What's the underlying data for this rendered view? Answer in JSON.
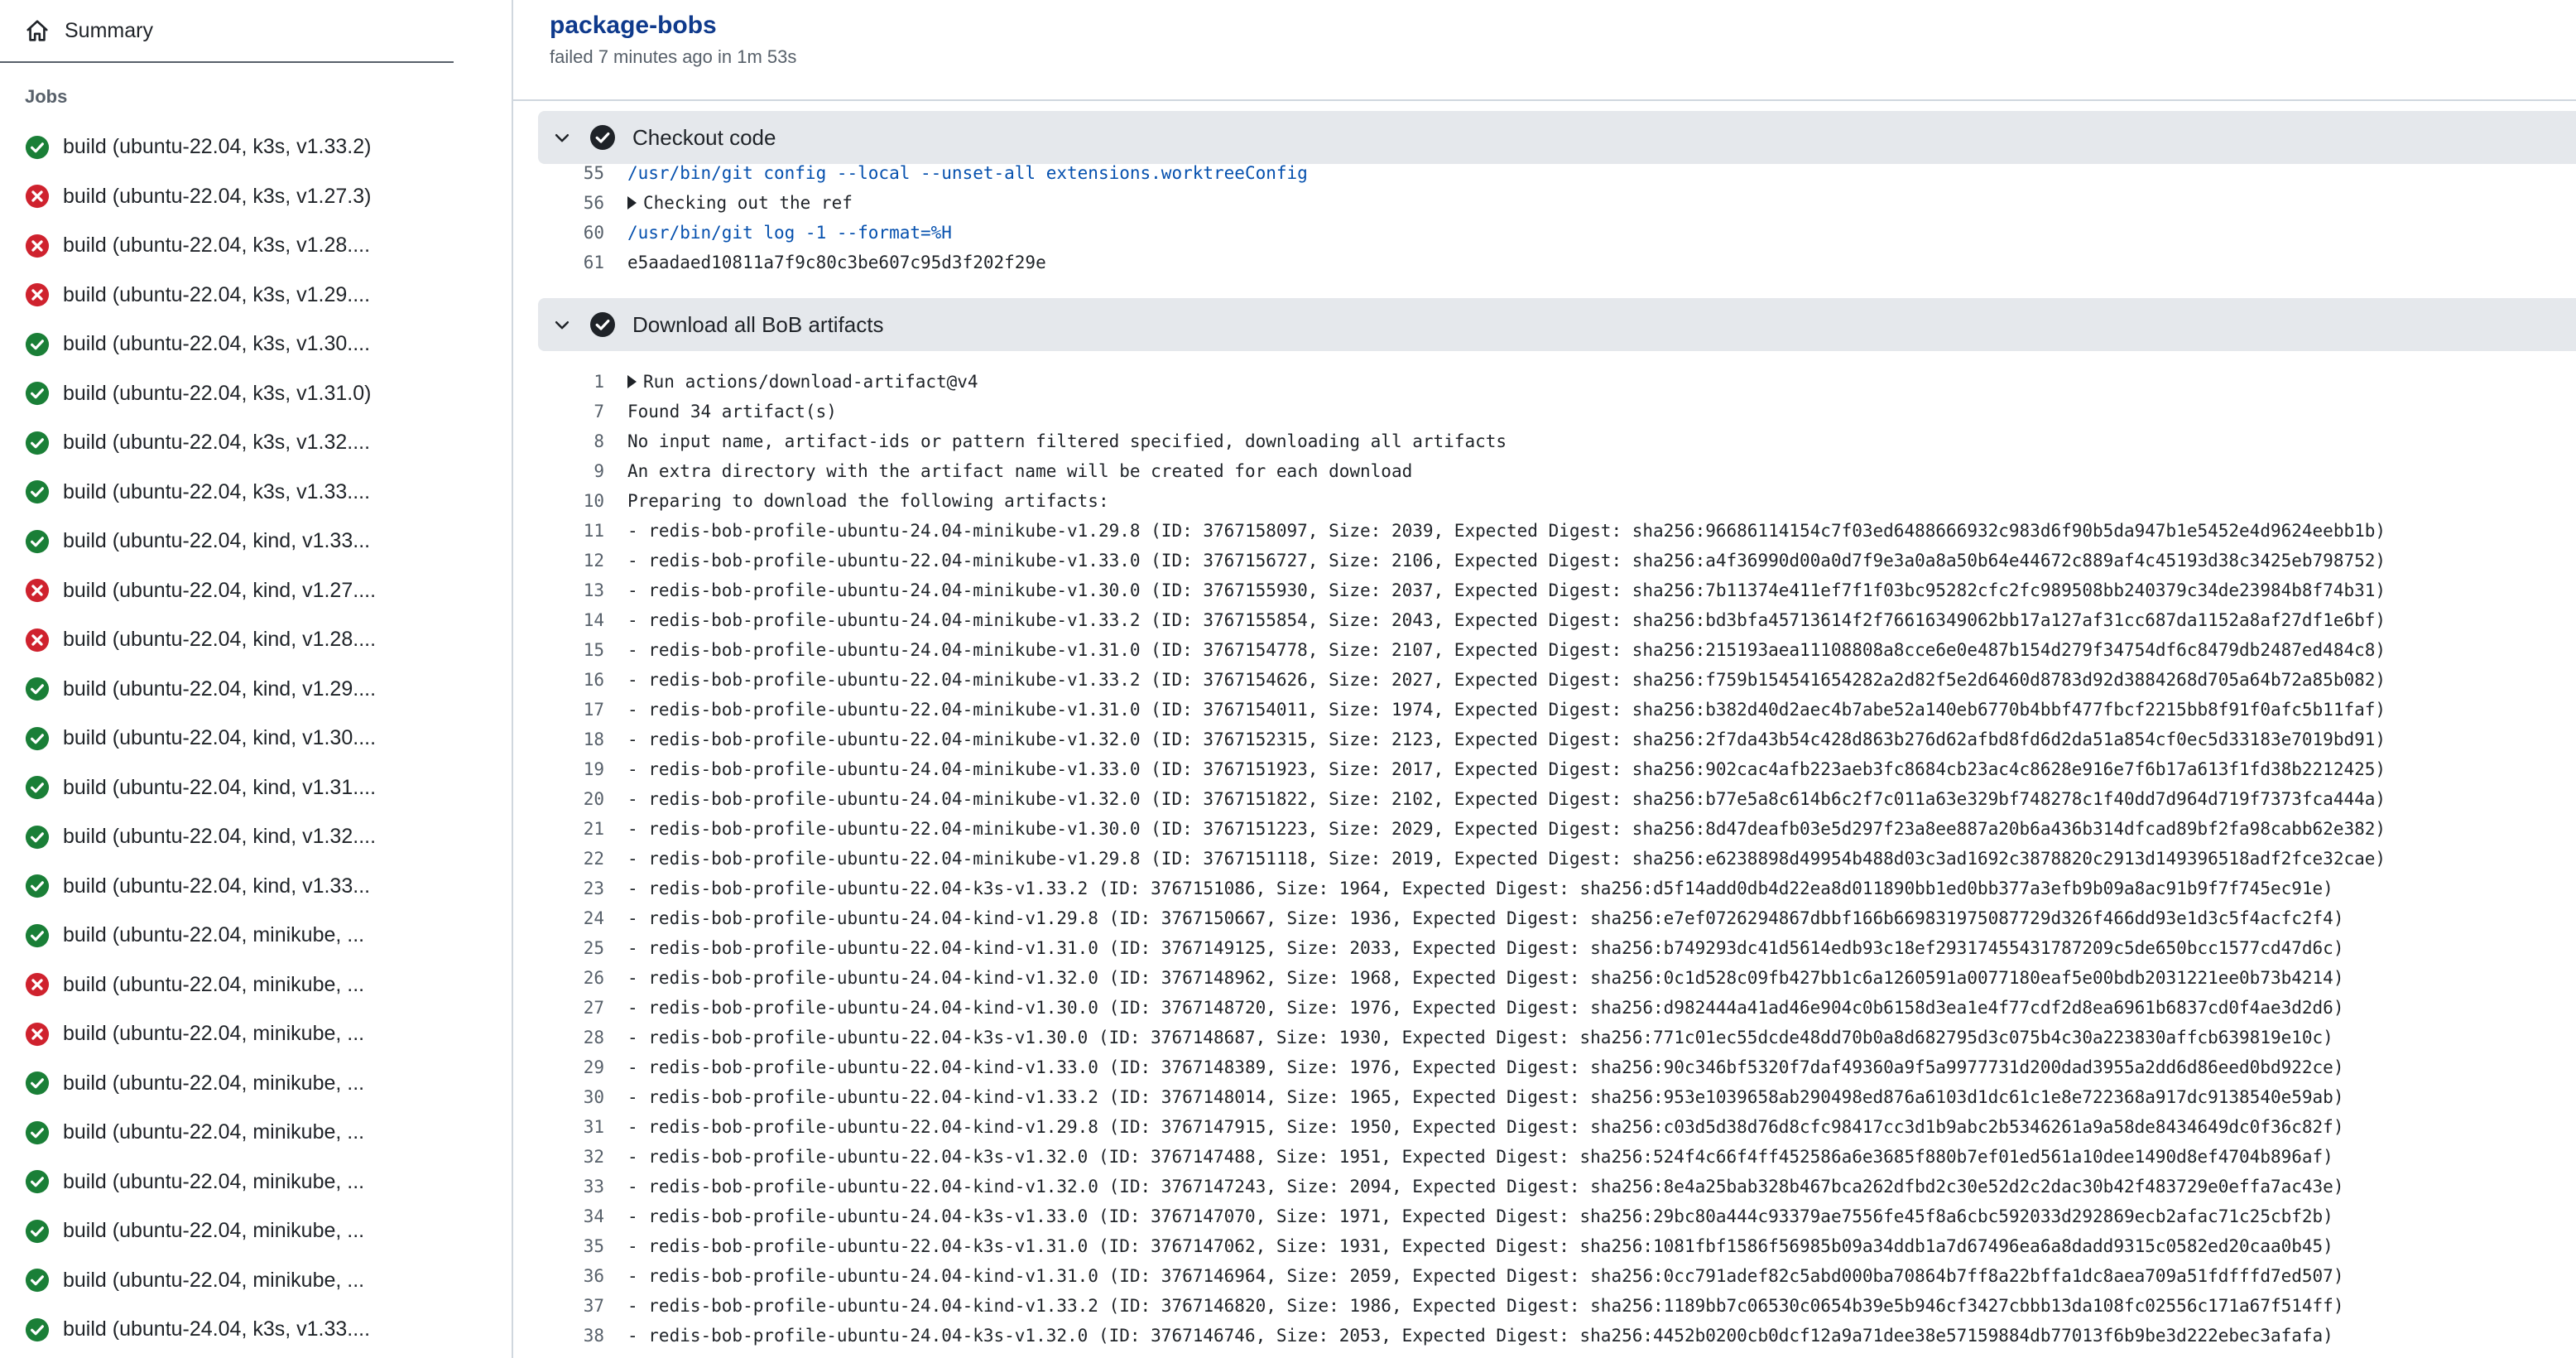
{
  "sidebar": {
    "summary_label": "Summary",
    "jobs_heading": "Jobs",
    "jobs": [
      {
        "label": "build (ubuntu-22.04, k3s, v1.33.2)",
        "status": "success"
      },
      {
        "label": "build (ubuntu-22.04, k3s, v1.27.3)",
        "status": "failure"
      },
      {
        "label": "build (ubuntu-22.04, k3s, v1.28....",
        "status": "failure"
      },
      {
        "label": "build (ubuntu-22.04, k3s, v1.29....",
        "status": "failure"
      },
      {
        "label": "build (ubuntu-22.04, k3s, v1.30....",
        "status": "success"
      },
      {
        "label": "build (ubuntu-22.04, k3s, v1.31.0)",
        "status": "success"
      },
      {
        "label": "build (ubuntu-22.04, k3s, v1.32....",
        "status": "success"
      },
      {
        "label": "build (ubuntu-22.04, k3s, v1.33....",
        "status": "success"
      },
      {
        "label": "build (ubuntu-22.04, kind, v1.33...",
        "status": "success"
      },
      {
        "label": "build (ubuntu-22.04, kind, v1.27....",
        "status": "failure"
      },
      {
        "label": "build (ubuntu-22.04, kind, v1.28....",
        "status": "failure"
      },
      {
        "label": "build (ubuntu-22.04, kind, v1.29....",
        "status": "success"
      },
      {
        "label": "build (ubuntu-22.04, kind, v1.30....",
        "status": "success"
      },
      {
        "label": "build (ubuntu-22.04, kind, v1.31....",
        "status": "success"
      },
      {
        "label": "build (ubuntu-22.04, kind, v1.32....",
        "status": "success"
      },
      {
        "label": "build (ubuntu-22.04, kind, v1.33...",
        "status": "success"
      },
      {
        "label": "build (ubuntu-22.04, minikube, ...",
        "status": "success"
      },
      {
        "label": "build (ubuntu-22.04, minikube, ...",
        "status": "failure"
      },
      {
        "label": "build (ubuntu-22.04, minikube, ...",
        "status": "failure"
      },
      {
        "label": "build (ubuntu-22.04, minikube, ...",
        "status": "success"
      },
      {
        "label": "build (ubuntu-22.04, minikube, ...",
        "status": "success"
      },
      {
        "label": "build (ubuntu-22.04, minikube, ...",
        "status": "success"
      },
      {
        "label": "build (ubuntu-22.04, minikube, ...",
        "status": "success"
      },
      {
        "label": "build (ubuntu-22.04, minikube, ...",
        "status": "success"
      },
      {
        "label": "build (ubuntu-24.04, k3s, v1.33....",
        "status": "success"
      }
    ]
  },
  "header": {
    "title": "package-bobs",
    "status": "failed 7 minutes ago in 1m 53s"
  },
  "colors": {
    "success": "#1a7f37",
    "failure": "#cf222e",
    "title": "#0f3a8c"
  },
  "steps": [
    {
      "name": "Checkout code",
      "lines": [
        {
          "n": "55",
          "t": "/usr/bin/git config --local --unset-all extensions.worktreeConfig",
          "kind": "cmd"
        },
        {
          "n": "56",
          "t": "Checking out the ref",
          "kind": "group"
        },
        {
          "n": "60",
          "t": "/usr/bin/git log -1 --format=%H",
          "kind": "cmd"
        },
        {
          "n": "61",
          "t": "e5aadaed10811a7f9c80c3be607c95d3f202f29e",
          "kind": "text"
        }
      ]
    },
    {
      "name": "Download all BoB artifacts",
      "lines": [
        {
          "n": "1",
          "t": "Run actions/download-artifact@v4",
          "kind": "group"
        },
        {
          "n": "7",
          "t": "Found 34 artifact(s)",
          "kind": "text"
        },
        {
          "n": "8",
          "t": "No input name, artifact-ids or pattern filtered specified, downloading all artifacts",
          "kind": "text"
        },
        {
          "n": "9",
          "t": "An extra directory with the artifact name will be created for each download",
          "kind": "text"
        },
        {
          "n": "10",
          "t": "Preparing to download the following artifacts:",
          "kind": "text"
        },
        {
          "n": "11",
          "t": "- redis-bob-profile-ubuntu-24.04-minikube-v1.29.8 (ID: 3767158097, Size: 2039, Expected Digest: sha256:96686114154c7f03ed6488666932c983d6f90b5da947b1e5452e4d9624eebb1b)",
          "kind": "text"
        },
        {
          "n": "12",
          "t": "- redis-bob-profile-ubuntu-22.04-minikube-v1.33.0 (ID: 3767156727, Size: 2106, Expected Digest: sha256:a4f36990d00a0d7f9e3a0a8a50b64e44672c889af4c45193d38c3425eb798752)",
          "kind": "text"
        },
        {
          "n": "13",
          "t": "- redis-bob-profile-ubuntu-24.04-minikube-v1.30.0 (ID: 3767155930, Size: 2037, Expected Digest: sha256:7b11374e411ef7f1f03bc95282cfc2fc989508bb240379c34de23984b8f74b31)",
          "kind": "text"
        },
        {
          "n": "14",
          "t": "- redis-bob-profile-ubuntu-24.04-minikube-v1.33.2 (ID: 3767155854, Size: 2043, Expected Digest: sha256:bd3bfa45713614f2f76616349062bb17a127af31cc687da1152a8af27df1e6bf)",
          "kind": "text"
        },
        {
          "n": "15",
          "t": "- redis-bob-profile-ubuntu-24.04-minikube-v1.31.0 (ID: 3767154778, Size: 2107, Expected Digest: sha256:215193aea11108808a8cce6e0e487b154d279f34754df6c8479db2487ed484c8)",
          "kind": "text"
        },
        {
          "n": "16",
          "t": "- redis-bob-profile-ubuntu-22.04-minikube-v1.33.2 (ID: 3767154626, Size: 2027, Expected Digest: sha256:f759b154541654282a2d82f5e2d6460d8783d92d3884268d705a64b72a85b082)",
          "kind": "text"
        },
        {
          "n": "17",
          "t": "- redis-bob-profile-ubuntu-22.04-minikube-v1.31.0 (ID: 3767154011, Size: 1974, Expected Digest: sha256:b382d40d2aec4b7abe52a140eb6770b4bbf477fbcf2215bb8f91f0afc5b11faf)",
          "kind": "text"
        },
        {
          "n": "18",
          "t": "- redis-bob-profile-ubuntu-22.04-minikube-v1.32.0 (ID: 3767152315, Size: 2123, Expected Digest: sha256:2f7da43b54c428d863b276d62afbd8fd6d2da51a854cf0ec5d33183e7019bd91)",
          "kind": "text"
        },
        {
          "n": "19",
          "t": "- redis-bob-profile-ubuntu-24.04-minikube-v1.33.0 (ID: 3767151923, Size: 2017, Expected Digest: sha256:902cac4afb223aeb3fc8684cb23ac4c8628e916e7f6b17a613f1fd38b2212425)",
          "kind": "text"
        },
        {
          "n": "20",
          "t": "- redis-bob-profile-ubuntu-24.04-minikube-v1.32.0 (ID: 3767151822, Size: 2102, Expected Digest: sha256:b77e5a8c614b6c2f7c011a63e329bf748278c1f40dd7d964d719f7373fca444a)",
          "kind": "text"
        },
        {
          "n": "21",
          "t": "- redis-bob-profile-ubuntu-22.04-minikube-v1.30.0 (ID: 3767151223, Size: 2029, Expected Digest: sha256:8d47deafb03e5d297f23a8ee887a20b6a436b314dfcad89bf2fa98cabb62e382)",
          "kind": "text"
        },
        {
          "n": "22",
          "t": "- redis-bob-profile-ubuntu-22.04-minikube-v1.29.8 (ID: 3767151118, Size: 2019, Expected Digest: sha256:e6238898d49954b488d03c3ad1692c3878820c2913d149396518adf2fce32cae)",
          "kind": "text"
        },
        {
          "n": "23",
          "t": "- redis-bob-profile-ubuntu-22.04-k3s-v1.33.2 (ID: 3767151086, Size: 1964, Expected Digest: sha256:d5f14add0db4d22ea8d011890bb1ed0bb377a3efb9b09a8ac91b9f7f745ec91e)",
          "kind": "text"
        },
        {
          "n": "24",
          "t": "- redis-bob-profile-ubuntu-24.04-kind-v1.29.8 (ID: 3767150667, Size: 1936, Expected Digest: sha256:e7ef0726294867dbbf166b669831975087729d326f466dd93e1d3c5f4acfc2f4)",
          "kind": "text"
        },
        {
          "n": "25",
          "t": "- redis-bob-profile-ubuntu-22.04-kind-v1.31.0 (ID: 3767149125, Size: 2033, Expected Digest: sha256:b749293dc41d5614edb93c18ef29317455431787209c5de650bcc1577cd47d6c)",
          "kind": "text"
        },
        {
          "n": "26",
          "t": "- redis-bob-profile-ubuntu-24.04-kind-v1.32.0 (ID: 3767148962, Size: 1968, Expected Digest: sha256:0c1d528c09fb427bb1c6a1260591a0077180eaf5e00bdb2031221ee0b73b4214)",
          "kind": "text"
        },
        {
          "n": "27",
          "t": "- redis-bob-profile-ubuntu-24.04-kind-v1.30.0 (ID: 3767148720, Size: 1976, Expected Digest: sha256:d982444a41ad46e904c0b6158d3ea1e4f77cdf2d8ea6961b6837cd0f4ae3d2d6)",
          "kind": "text"
        },
        {
          "n": "28",
          "t": "- redis-bob-profile-ubuntu-22.04-k3s-v1.30.0 (ID: 3767148687, Size: 1930, Expected Digest: sha256:771c01ec55dcde48dd70b0a8d682795d3c075b4c30a223830affcb639819e10c)",
          "kind": "text"
        },
        {
          "n": "29",
          "t": "- redis-bob-profile-ubuntu-22.04-kind-v1.33.0 (ID: 3767148389, Size: 1976, Expected Digest: sha256:90c346bf5320f7daf49360a9f5a9977731d200dad3955a2dd6d86eed0bd922ce)",
          "kind": "text"
        },
        {
          "n": "30",
          "t": "- redis-bob-profile-ubuntu-22.04-kind-v1.33.2 (ID: 3767148014, Size: 1965, Expected Digest: sha256:953e1039658ab290498ed876a6103d1dc61c1e8e722368a917dc9138540e59ab)",
          "kind": "text"
        },
        {
          "n": "31",
          "t": "- redis-bob-profile-ubuntu-22.04-kind-v1.29.8 (ID: 3767147915, Size: 1950, Expected Digest: sha256:c03d5d38d76d8cfc98417cc3d1b9abc2b5346261a9a58de8434649dc0f36c82f)",
          "kind": "text"
        },
        {
          "n": "32",
          "t": "- redis-bob-profile-ubuntu-22.04-k3s-v1.32.0 (ID: 3767147488, Size: 1951, Expected Digest: sha256:524f4c66f4ff452586a6e3685f880b7ef01ed561a10dee1490d8ef4704b896af)",
          "kind": "text"
        },
        {
          "n": "33",
          "t": "- redis-bob-profile-ubuntu-22.04-kind-v1.32.0 (ID: 3767147243, Size: 2094, Expected Digest: sha256:8e4a25bab328b467bca262dfbd2c30e52d2c2dac30b42f483729e0effa7ac43e)",
          "kind": "text"
        },
        {
          "n": "34",
          "t": "- redis-bob-profile-ubuntu-24.04-k3s-v1.33.0 (ID: 3767147070, Size: 1971, Expected Digest: sha256:29bc80a444c93379ae7556fe45f8a6cbc592033d292869ecb2afac71c25cbf2b)",
          "kind": "text"
        },
        {
          "n": "35",
          "t": "- redis-bob-profile-ubuntu-22.04-k3s-v1.31.0 (ID: 3767147062, Size: 1931, Expected Digest: sha256:1081fbf1586f56985b09a34ddb1a7d67496ea6a8dadd9315c0582ed20caa0b45)",
          "kind": "text"
        },
        {
          "n": "36",
          "t": "- redis-bob-profile-ubuntu-24.04-kind-v1.31.0 (ID: 3767146964, Size: 2059, Expected Digest: sha256:0cc791adef82c5abd000ba70864b7ff8a22bffa1dc8aea709a51fdfffd7ed507)",
          "kind": "text"
        },
        {
          "n": "37",
          "t": "- redis-bob-profile-ubuntu-24.04-kind-v1.33.2 (ID: 3767146820, Size: 1986, Expected Digest: sha256:1189bb7c06530c0654b39e5b946cf3427cbbb13da108fc02556c171a67f514ff)",
          "kind": "text"
        },
        {
          "n": "38",
          "t": "- redis-bob-profile-ubuntu-24.04-k3s-v1.32.0 (ID: 3767146746, Size: 2053, Expected Digest: sha256:4452b0200cb0dcf12a9a71dee38e57159884db77013f6b9be3d222ebec3afafa)",
          "kind": "text"
        }
      ]
    }
  ]
}
